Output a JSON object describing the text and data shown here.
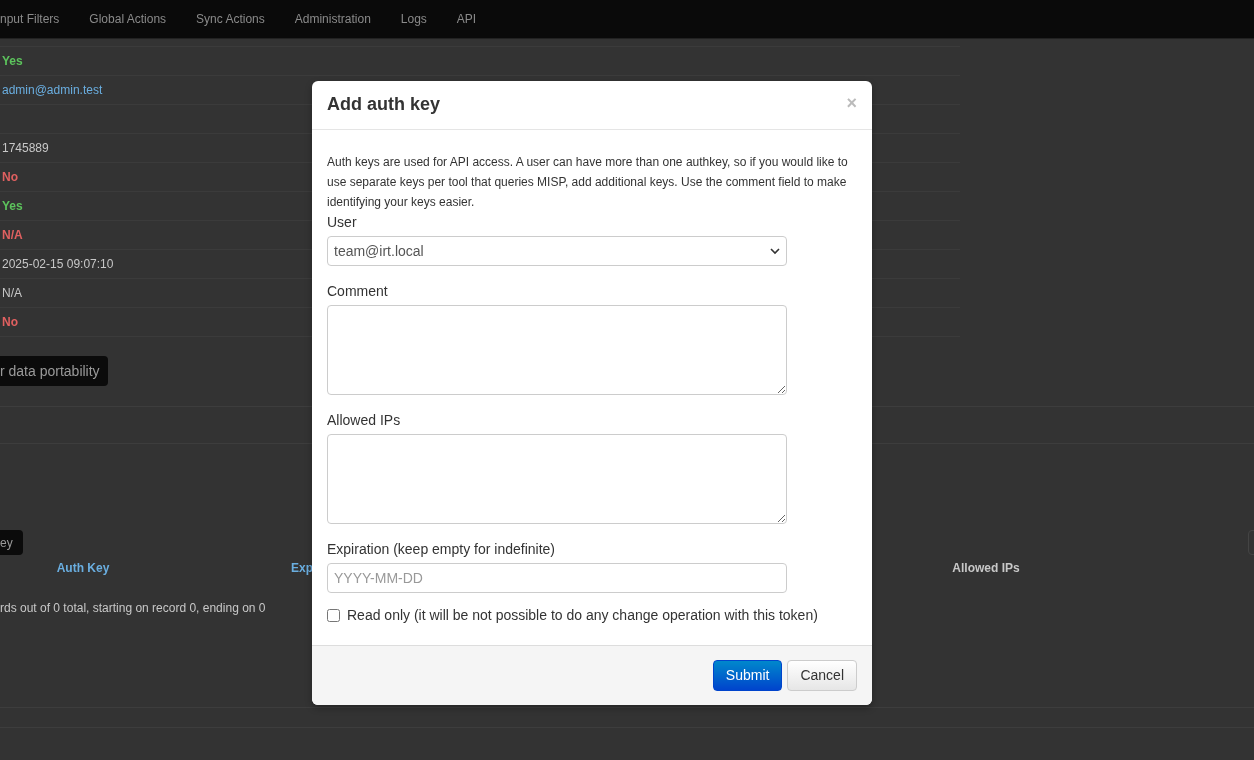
{
  "navbar": {
    "items": [
      "nput Filters",
      "Global Actions",
      "Sync Actions",
      "Administration",
      "Logs",
      "API"
    ]
  },
  "details": {
    "rows": [
      {
        "value": "Yes",
        "kind": "yes"
      },
      {
        "value": "admin@admin.test",
        "kind": "link"
      },
      {
        "kind": "blank"
      },
      {
        "value": "1745889",
        "kind": "plain"
      },
      {
        "value": "No",
        "kind": "no"
      },
      {
        "value": "Yes",
        "kind": "yes"
      },
      {
        "value": "N/A",
        "kind": "no"
      },
      {
        "value": "2025-02-15 09:07:10",
        "kind": "plain"
      },
      {
        "value": "N/A",
        "kind": "plain"
      },
      {
        "value": "No",
        "kind": "no"
      }
    ]
  },
  "portability_button": "r data portability",
  "authkeys": {
    "add_button": "ey",
    "columns": [
      {
        "label": "Auth Key",
        "kind": "link"
      },
      {
        "label": "Exp",
        "kind": "link"
      },
      {
        "label": "Allowed IPs",
        "kind": "plain"
      }
    ],
    "pagination": "rds out of 0 total, starting on record 0, ending on 0"
  },
  "modal": {
    "title": "Add auth key",
    "close": "×",
    "intro": "Auth keys are used for API access. A user can have more than one authkey, so if you would like to use separate keys per tool that queries MISP, add additional keys. Use the comment field to make identifying your keys easier.",
    "fields": [
      {
        "label": "User",
        "kind": "select",
        "value": "team@irt.local"
      },
      {
        "label": "Comment",
        "kind": "textarea"
      },
      {
        "label": "Allowed IPs",
        "kind": "textarea"
      },
      {
        "label": "Expiration (keep empty for indefinite)",
        "kind": "input",
        "placeholder": "YYYY-MM-DD"
      }
    ],
    "read_only": {
      "label": "Read only (it will be not possible to do any change operation with this token)",
      "checked": false
    },
    "buttons": [
      {
        "label": "Submit",
        "kind": "primary"
      },
      {
        "label": "Cancel",
        "kind": "secondary"
      }
    ]
  }
}
